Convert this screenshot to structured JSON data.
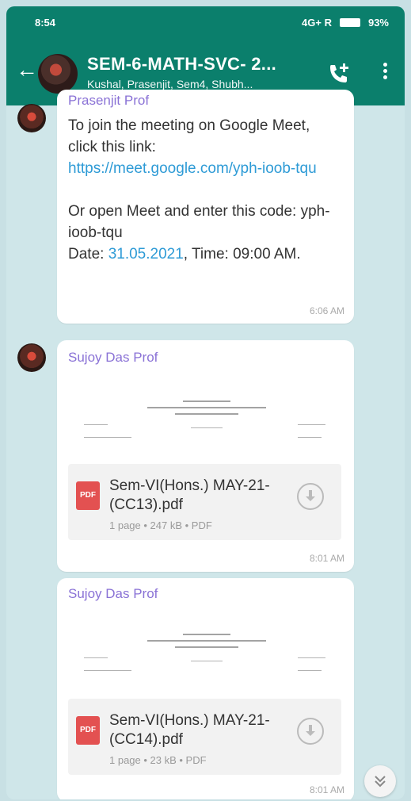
{
  "status_bar": {
    "time": "8:54",
    "network": "4G+ R",
    "battery_pct": "93%"
  },
  "header": {
    "title": "SEM-6-MATH-SVC- 2...",
    "subtitle": "Kushal, Prasenjit, Sem4, Shubh..."
  },
  "messages": [
    {
      "sender": "Prasenjit Prof",
      "text_before_link": "To join the meeting on Google Meet, click this link:",
      "link": "https://meet.google.com/yph-ioob-tqu",
      "text_code": "Or open Meet and enter this code: yph-ioob-tqu",
      "date_label": "Date: ",
      "date": "31.05.2021",
      "time_text": ", Time: 09:00 AM.",
      "timestamp": "6:06 AM"
    },
    {
      "sender": "Sujoy Das Prof",
      "file_name": "Sem-VI(Hons.) MAY-21-(CC13).pdf",
      "file_meta": "1 page • 247 kB • PDF",
      "pdf_badge": "PDF",
      "timestamp": "8:01 AM"
    },
    {
      "sender": "Sujoy Das Prof",
      "file_name": "Sem-VI(Hons.) MAY-21-(CC14).pdf",
      "file_meta": "1 page • 23 kB • PDF",
      "pdf_badge": "PDF",
      "timestamp": "8:01 AM"
    }
  ],
  "colors": {
    "header": "#0b7f6c",
    "sender": "#8a72d6",
    "link": "#2e9bd6",
    "pdf_icon": "#e35151"
  },
  "icons": [
    "back-arrow-icon",
    "add-call-icon",
    "more-vert-icon",
    "download-icon",
    "pdf-icon",
    "scroll-down-icon"
  ]
}
